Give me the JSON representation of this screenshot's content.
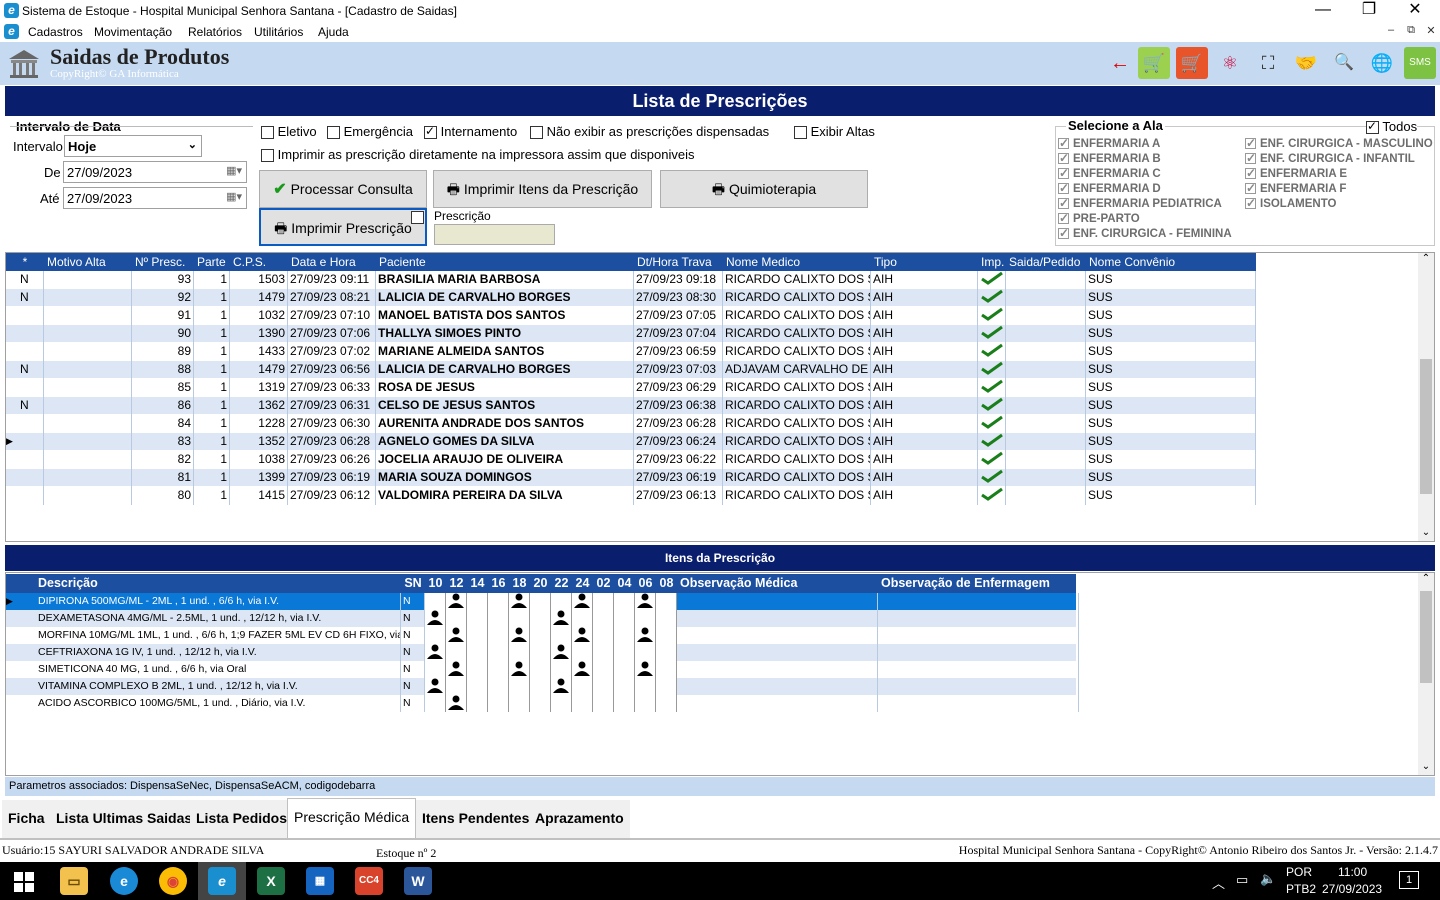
{
  "window": {
    "title": "Sistema de Estoque - Hospital Municipal Senhora Santana - [Cadastro de Saidas]",
    "minimize": "—",
    "maximize": "❐",
    "close": "✕"
  },
  "menu": [
    "Cadastros",
    "Movimentação",
    "Relatórios",
    "Utilitários",
    "Ajuda"
  ],
  "header": {
    "title": "Saidas de Produtos",
    "copyright": "CopyRight© GA Informática"
  },
  "list_title": "Lista de Prescrições",
  "intervalo": {
    "group_label": "Intervalo de Data",
    "intervalo_label": "Intervalo",
    "intervalo_value": "Hoje",
    "de_label": "De",
    "de_value": "27/09/2023",
    "ate_label": "Até",
    "ate_value": "27/09/2023"
  },
  "filters": {
    "eletivo": "Eletivo",
    "emergencia": "Emergência",
    "internamento": "Internamento",
    "nao_exibir": "Não exibir as prescrições dispensadas",
    "exibir_altas": "Exibir Altas",
    "imprimir_direto": "Imprimir as prescrição diretamente na impressora assim que disponiveis"
  },
  "buttons": {
    "processar": "Processar Consulta",
    "imprimir_itens": "Imprimir Itens da Prescrição",
    "quimioterapia": "Quimioterapia",
    "imprimir_prescricao": "Imprimir Prescrição",
    "prescricao_label": "Prescrição"
  },
  "ala": {
    "title": "Selecione a Ala",
    "todos": "Todos",
    "left": [
      "ENFERMARIA A",
      "ENFERMARIA B",
      "ENFERMARIA C",
      "ENFERMARIA D",
      "ENFERMARIA PEDIATRICA",
      "PRE-PARTO",
      "ENF. CIRURGICA - FEMININA"
    ],
    "right": [
      "ENF. CIRURGICA - MASCULINO",
      "ENF. CIRURGICA - INFANTIL",
      "ENFERMARIA E",
      "ENFERMARIA F",
      "ISOLAMENTO"
    ]
  },
  "pres_grid": {
    "columns": [
      "*",
      "Motivo Alta",
      "Nº Presc.",
      "Parte",
      "C.P.S.",
      "Data e Hora",
      "Paciente",
      "Dt/Hora Trava",
      "Nome Medico",
      "Tipo",
      "Imp.",
      "Saida/Pedido",
      "Nome Convênio"
    ],
    "rows": [
      [
        "N",
        "",
        "93",
        "1",
        "1503",
        "27/09/23 09:11",
        "BRASILIA MARIA BARBOSA",
        "27/09/23 09:18",
        "RICARDO CALIXTO DOS S",
        "AIH",
        "",
        "SUS"
      ],
      [
        "N",
        "",
        "92",
        "1",
        "1479",
        "27/09/23 08:21",
        "LALICIA DE CARVALHO BORGES",
        "27/09/23 08:30",
        "RICARDO CALIXTO DOS S",
        "AIH",
        "",
        "SUS"
      ],
      [
        "",
        "",
        "91",
        "1",
        "1032",
        "27/09/23 07:10",
        "MANOEL BATISTA DOS SANTOS",
        "27/09/23 07:05",
        "RICARDO CALIXTO DOS S",
        "AIH",
        "",
        "SUS"
      ],
      [
        "",
        "",
        "90",
        "1",
        "1390",
        "27/09/23 07:06",
        "THALLYA SIMOES PINTO",
        "27/09/23 07:04",
        "RICARDO CALIXTO DOS S",
        "AIH",
        "",
        "SUS"
      ],
      [
        "",
        "",
        "89",
        "1",
        "1433",
        "27/09/23 07:02",
        "MARIANE ALMEIDA SANTOS",
        "27/09/23 06:59",
        "RICARDO CALIXTO DOS S",
        "AIH",
        "",
        "SUS"
      ],
      [
        "N",
        "",
        "88",
        "1",
        "1479",
        "27/09/23 06:56",
        "LALICIA DE CARVALHO BORGES",
        "27/09/23 07:03",
        "ADJAVAM CARVALHO DE",
        "AIH",
        "",
        "SUS"
      ],
      [
        "",
        "",
        "85",
        "1",
        "1319",
        "27/09/23 06:33",
        "ROSA DE JESUS",
        "27/09/23 06:29",
        "RICARDO CALIXTO DOS S",
        "AIH",
        "",
        "SUS"
      ],
      [
        "N",
        "",
        "86",
        "1",
        "1362",
        "27/09/23 06:31",
        "CELSO DE JESUS SANTOS",
        "27/09/23 06:38",
        "RICARDO CALIXTO DOS S",
        "AIH",
        "",
        "SUS"
      ],
      [
        "",
        "",
        "84",
        "1",
        "1228",
        "27/09/23 06:30",
        "AURENITA ANDRADE DOS SANTOS",
        "27/09/23 06:28",
        "RICARDO CALIXTO DOS S",
        "AIH",
        "",
        "SUS"
      ],
      [
        "",
        "",
        "83",
        "1",
        "1352",
        "27/09/23 06:28",
        "AGNELO GOMES DA SILVA",
        "27/09/23 06:24",
        "RICARDO CALIXTO DOS S",
        "AIH",
        "",
        "SUS"
      ],
      [
        "",
        "",
        "82",
        "1",
        "1038",
        "27/09/23 06:26",
        "JOCELIA ARAUJO DE OLIVEIRA",
        "27/09/23 06:22",
        "RICARDO CALIXTO DOS S",
        "AIH",
        "",
        "SUS"
      ],
      [
        "",
        "",
        "81",
        "1",
        "1399",
        "27/09/23 06:19",
        "MARIA SOUZA DOMINGOS",
        "27/09/23 06:19",
        "RICARDO CALIXTO DOS S",
        "AIH",
        "",
        "SUS"
      ],
      [
        "",
        "",
        "80",
        "1",
        "1415",
        "27/09/23 06:12",
        "VALDOMIRA PEREIRA DA SILVA",
        "27/09/23 06:13",
        "RICARDO CALIXTO DOS S",
        "AIH",
        "",
        "SUS"
      ]
    ]
  },
  "items_title": "Itens da Prescrição",
  "items_grid": {
    "columns": [
      "Descrição",
      "SN",
      "10",
      "12",
      "14",
      "16",
      "18",
      "20",
      "22",
      "24",
      "02",
      "04",
      "06",
      "08",
      "Observação Médica",
      "Observação de Enfermagem"
    ],
    "rows": [
      {
        "desc": "DIPIRONA 500MG/ML - 2ML , 1 und. , 6/6 h, via I.V.",
        "sn": "N",
        "marks": [
          12,
          18,
          24,
          6
        ]
      },
      {
        "desc": "DEXAMETASONA 4MG/ML - 2.5ML, 1 und. , 12/12 h, via I.V.",
        "sn": "N",
        "marks": [
          10,
          22
        ]
      },
      {
        "desc": "MORFINA 10MG/ML 1ML, 1 und. , 6/6 h, 1;9 FAZER 5ML EV CD 6H FIXO, via",
        "sn": "N",
        "marks": [
          12,
          18,
          24,
          6
        ]
      },
      {
        "desc": "CEFTRIAXONA 1G IV, 1 und. , 12/12 h, via I.V.",
        "sn": "N",
        "marks": [
          10,
          22
        ]
      },
      {
        "desc": "SIMETICONA 40 MG, 1 und. , 6/6 h, via Oral",
        "sn": "N",
        "marks": [
          12,
          18,
          24,
          6
        ]
      },
      {
        "desc": "VITAMINA COMPLEXO B  2ML, 1 und. , 12/12 h, via I.V.",
        "sn": "N",
        "marks": [
          10,
          22
        ]
      },
      {
        "desc": "ACIDO ASCORBICO 100MG/5ML, 1 und. , Diário, via I.V.",
        "sn": "N",
        "marks": [
          12
        ]
      }
    ]
  },
  "params": "Parametros associados: DispensaSeNec, DispensaSeACM, codigodebarra",
  "tabs": [
    "Ficha",
    "Lista Ultimas Saidas",
    "Lista Pedidos",
    "Prescrição Médica",
    "Itens Pendentes",
    "Aprazamento"
  ],
  "status": {
    "user": "Usuário:15 SAYURI SALVADOR ANDRADE SILVA",
    "estoque": "Estoque nº 2",
    "right": "Hospital Municipal Senhora Santana - CopyRight© Antonio Ribeiro dos Santos Jr. - Versão: 2.1.4.7"
  },
  "taskbar": {
    "lang1": "POR",
    "lang2": "PTB2",
    "time": "11:00",
    "date": "27/09/2023",
    "notif": "1"
  }
}
